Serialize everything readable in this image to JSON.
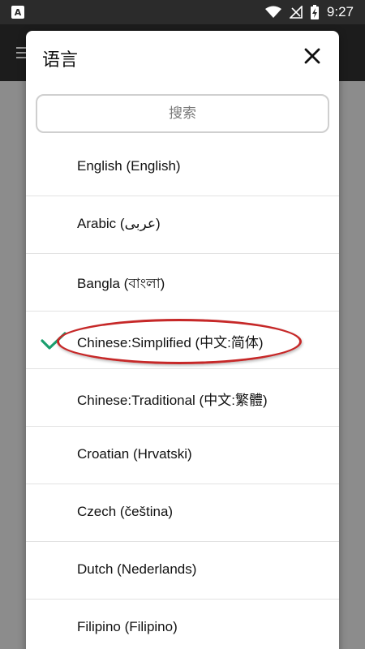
{
  "status_bar": {
    "app_icon_letter": "A",
    "time": "9:27"
  },
  "dialog": {
    "title": "语言",
    "search_placeholder": "搜索",
    "selected_index": 3,
    "accent_color": "#1a9e6e",
    "highlight_color": "#c62828",
    "languages": [
      {
        "label": "English (English)"
      },
      {
        "label": "Arabic (عربى)"
      },
      {
        "label": "Bangla (বাংলা)"
      },
      {
        "label": "Chinese:Simplified (中文:简体)"
      },
      {
        "label": "Chinese:Traditional (中文:繁體)"
      },
      {
        "label": "Croatian (Hrvatski)"
      },
      {
        "label": "Czech (čeština)"
      },
      {
        "label": "Dutch (Nederlands)"
      },
      {
        "label": "Filipino (Filipino)"
      }
    ]
  }
}
